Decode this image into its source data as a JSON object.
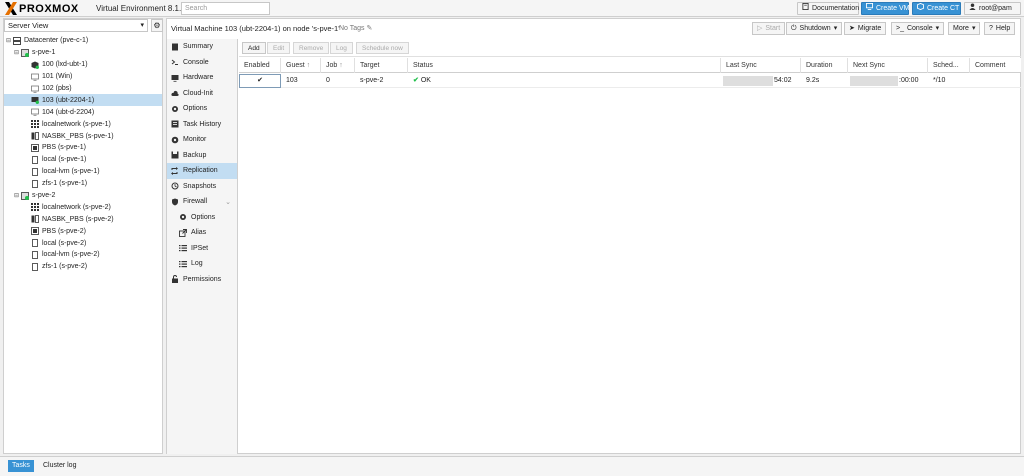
{
  "header": {
    "logo_text": "PROXMOX",
    "version": "Virtual Environment 8.1.4",
    "search_placeholder": "Search",
    "documentation_label": "Documentation",
    "create_vm_label": "Create VM",
    "create_ct_label": "Create CT",
    "user_label": "root@pam"
  },
  "tree": {
    "view_label": "Server View",
    "items": [
      {
        "label": "Datacenter (pve-c-1)",
        "icon": "server-icon"
      },
      {
        "label": "s-pve-1",
        "icon": "node-icon"
      },
      {
        "label": "100 (lxd-ubt-1)",
        "icon": "container-icon"
      },
      {
        "label": "101 (Win)",
        "icon": "vm-icon"
      },
      {
        "label": "102 (pbs)",
        "icon": "vm-icon"
      },
      {
        "label": "103 (ubt-2204-1)",
        "icon": "vm-icon"
      },
      {
        "label": "104 (ubt-d-2204)",
        "icon": "vm-icon"
      },
      {
        "label": "localnetwork (s-pve-1)",
        "icon": "network-icon"
      },
      {
        "label": "NASBK_PBS (s-pve-1)",
        "icon": "storage-icon"
      },
      {
        "label": "PBS (s-pve-1)",
        "icon": "pbs-icon"
      },
      {
        "label": "local (s-pve-1)",
        "icon": "storage-icon"
      },
      {
        "label": "local-lvm (s-pve-1)",
        "icon": "storage-icon"
      },
      {
        "label": "zfs-1 (s-pve-1)",
        "icon": "storage-icon"
      },
      {
        "label": "s-pve-2",
        "icon": "node-icon"
      },
      {
        "label": "localnetwork (s-pve-2)",
        "icon": "network-icon"
      },
      {
        "label": "NASBK_PBS (s-pve-2)",
        "icon": "storage-icon"
      },
      {
        "label": "PBS (s-pve-2)",
        "icon": "pbs-icon"
      },
      {
        "label": "local (s-pve-2)",
        "icon": "storage-icon"
      },
      {
        "label": "local-lvm (s-pve-2)",
        "icon": "storage-icon"
      },
      {
        "label": "zfs-1 (s-pve-2)",
        "icon": "storage-icon"
      }
    ]
  },
  "content": {
    "title": "Virtual Machine 103 (ubt-2204-1) on node 's-pve-1'",
    "tags": "No Tags",
    "actions": {
      "start": "Start",
      "shutdown": "Shutdown",
      "migrate": "Migrate",
      "console": "Console",
      "more": "More",
      "help": "Help"
    }
  },
  "nav": {
    "items": [
      {
        "label": "Summary",
        "icon": "book-icon"
      },
      {
        "label": "Console",
        "icon": "terminal-icon"
      },
      {
        "label": "Hardware",
        "icon": "monitor-icon"
      },
      {
        "label": "Cloud-Init",
        "icon": "cloud-icon"
      },
      {
        "label": "Options",
        "icon": "gear-icon"
      },
      {
        "label": "Task History",
        "icon": "list-icon"
      },
      {
        "label": "Monitor",
        "icon": "eye-icon"
      },
      {
        "label": "Backup",
        "icon": "floppy-icon"
      },
      {
        "label": "Replication",
        "icon": "retweet-icon"
      },
      {
        "label": "Snapshots",
        "icon": "history-icon"
      },
      {
        "label": "Firewall",
        "icon": "shield-icon"
      },
      {
        "label": "Options",
        "icon": "gear-icon"
      },
      {
        "label": "Alias",
        "icon": "external-link-icon"
      },
      {
        "label": "IPSet",
        "icon": "list-icon"
      },
      {
        "label": "Log",
        "icon": "list-icon"
      },
      {
        "label": "Permissions",
        "icon": "unlock-icon"
      }
    ]
  },
  "replication": {
    "toolbar": {
      "add": "Add",
      "edit": "Edit",
      "remove": "Remove",
      "log": "Log",
      "schedule_now": "Schedule now"
    },
    "columns": [
      "Enabled",
      "Guest",
      "Job",
      "Target",
      "Status",
      "Last Sync",
      "Duration",
      "Next Sync",
      "Sched...",
      "Comment"
    ],
    "rows": [
      {
        "enabled": "✔",
        "guest": "103",
        "job": "0",
        "target": "s-pve-2",
        "status": "OK",
        "last_sync": "54:02",
        "duration": "9.2s",
        "next_sync": ":00:00",
        "schedule": "*/10",
        "comment": ""
      }
    ]
  },
  "bottom": {
    "tasks": "Tasks",
    "cluster_log": "Cluster log"
  },
  "colors": {
    "accent": "#3892d4",
    "proxmox_orange": "#e57000",
    "selection": "#c2ddf2",
    "ok_green": "#21bf4b"
  }
}
